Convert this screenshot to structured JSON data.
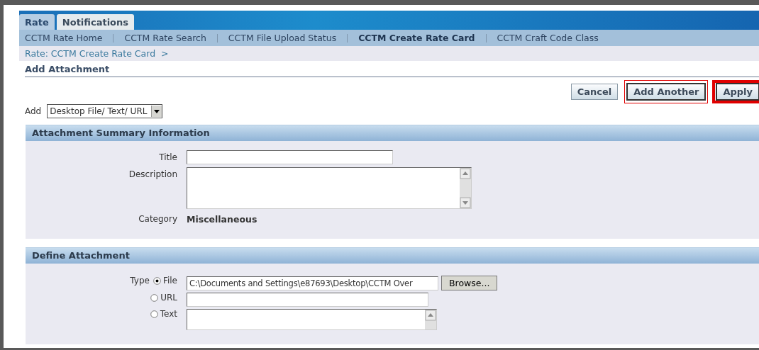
{
  "tabs": [
    {
      "label": "Rate",
      "selected": true
    },
    {
      "label": "Notifications",
      "selected": false
    }
  ],
  "subnav": [
    {
      "label": "CCTM Rate Home",
      "selected": false
    },
    {
      "label": "CCTM Rate Search",
      "selected": false
    },
    {
      "label": "CCTM File Upload Status",
      "selected": false
    },
    {
      "label": "CCTM Create Rate Card",
      "selected": true
    },
    {
      "label": "CCTM Craft Code Class",
      "selected": false
    }
  ],
  "breadcrumb": {
    "text": "Rate: CCTM Create Rate Card",
    "separator": ">"
  },
  "heading": "Add Attachment",
  "buttons": [
    {
      "label": "Cancel",
      "highlighted": false
    },
    {
      "label": "Add Another",
      "highlighted": true
    },
    {
      "label": "Apply",
      "highlighted": true
    }
  ],
  "add": {
    "label": "Add",
    "value": "Desktop File/ Text/ URL"
  },
  "summary": {
    "title": "Attachment Summary Information",
    "title_label": "Title",
    "description_label": "Description",
    "category_label": "Category",
    "category": "Miscellaneous"
  },
  "define": {
    "title": "Define Attachment",
    "type_label": "Type",
    "options": [
      {
        "kind": "file",
        "label": "File",
        "selected": true,
        "value": "C:\\Documents and Settings\\e87693\\Desktop\\CCTM Over",
        "button": "Browse..."
      },
      {
        "kind": "url",
        "label": "URL",
        "selected": false
      },
      {
        "kind": "text",
        "label": "Text",
        "selected": false
      }
    ]
  }
}
